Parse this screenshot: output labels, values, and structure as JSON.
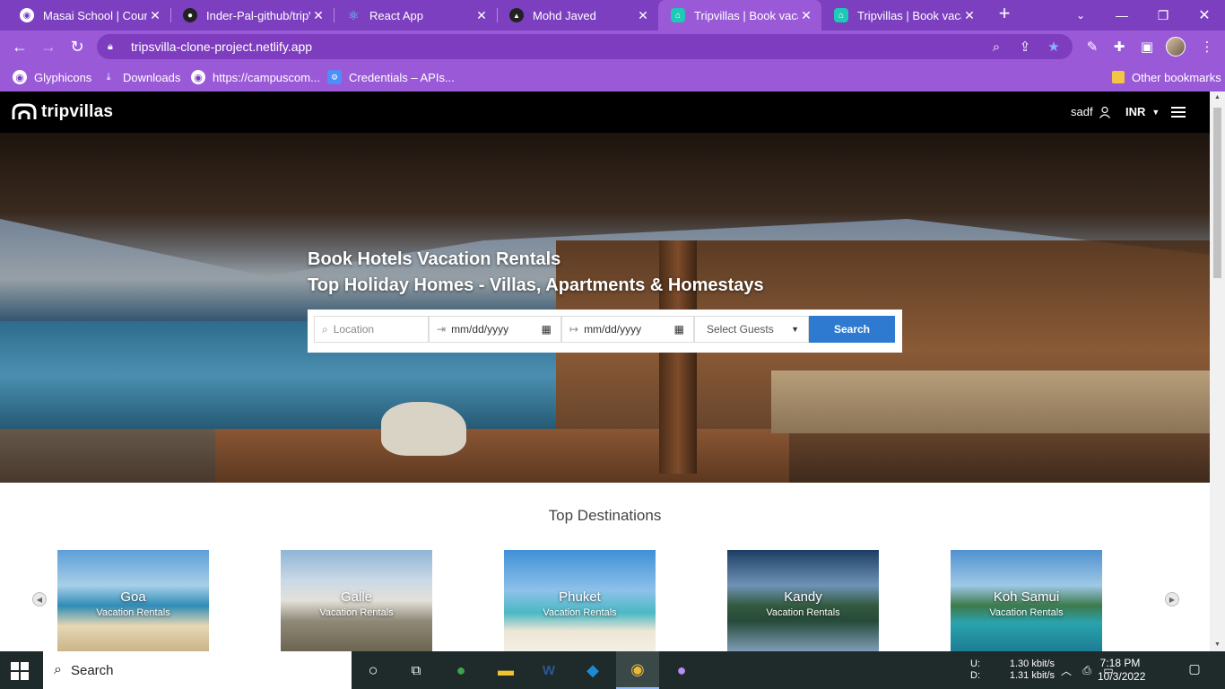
{
  "browser": {
    "tabs": [
      {
        "title": "Masai School | Course",
        "active": false
      },
      {
        "title": "Inder-Pal-github/tripV",
        "active": false
      },
      {
        "title": "React App",
        "active": false
      },
      {
        "title": "Mohd Javed",
        "active": false
      },
      {
        "title": "Tripvillas | Book vacati",
        "active": true
      },
      {
        "title": "Tripvillas | Book vacati",
        "active": false
      }
    ],
    "new_tab": "+",
    "url": "tripsvilla-clone-project.netlify.app",
    "bookmarks": [
      "Glyphicons",
      "Downloads",
      "https://campuscom...",
      "Credentials – APIs..."
    ],
    "other_bookmarks": "Other bookmarks"
  },
  "site": {
    "logo": "tripvillas",
    "user": "sadf",
    "currency": "INR",
    "hero": {
      "line1": "Book Hotels Vacation Rentals",
      "line2": "Top Holiday Homes - Villas, Apartments & Homestays"
    },
    "search": {
      "location_placeholder": "Location",
      "checkin_placeholder": "mm/dd/yyyy",
      "checkout_placeholder": "mm/dd/yyyy",
      "guests_label": "Select Guests",
      "button": "Search"
    },
    "destinations_title": "Top Destinations",
    "destinations": [
      {
        "name": "Goa",
        "subtitle": "Vacation Rentals"
      },
      {
        "name": "Galle",
        "subtitle": "Vacation Rentals"
      },
      {
        "name": "Phuket",
        "subtitle": "Vacation Rentals"
      },
      {
        "name": "Kandy",
        "subtitle": "Vacation Rentals"
      },
      {
        "name": "Koh Samui",
        "subtitle": "Vacation Rentals"
      }
    ]
  },
  "taskbar": {
    "search": "Search",
    "net_labels": [
      "U:",
      "D:"
    ],
    "net_rates": [
      "1.30 kbit/s",
      "1.31 kbit/s"
    ],
    "time": "7:18 PM",
    "date": "10/3/2022"
  },
  "colors": {
    "chrome_purple": "#7b3fbf",
    "chrome_toolbar": "#9a5ad8",
    "search_button": "#2f7ad1",
    "header_black": "#000000"
  }
}
